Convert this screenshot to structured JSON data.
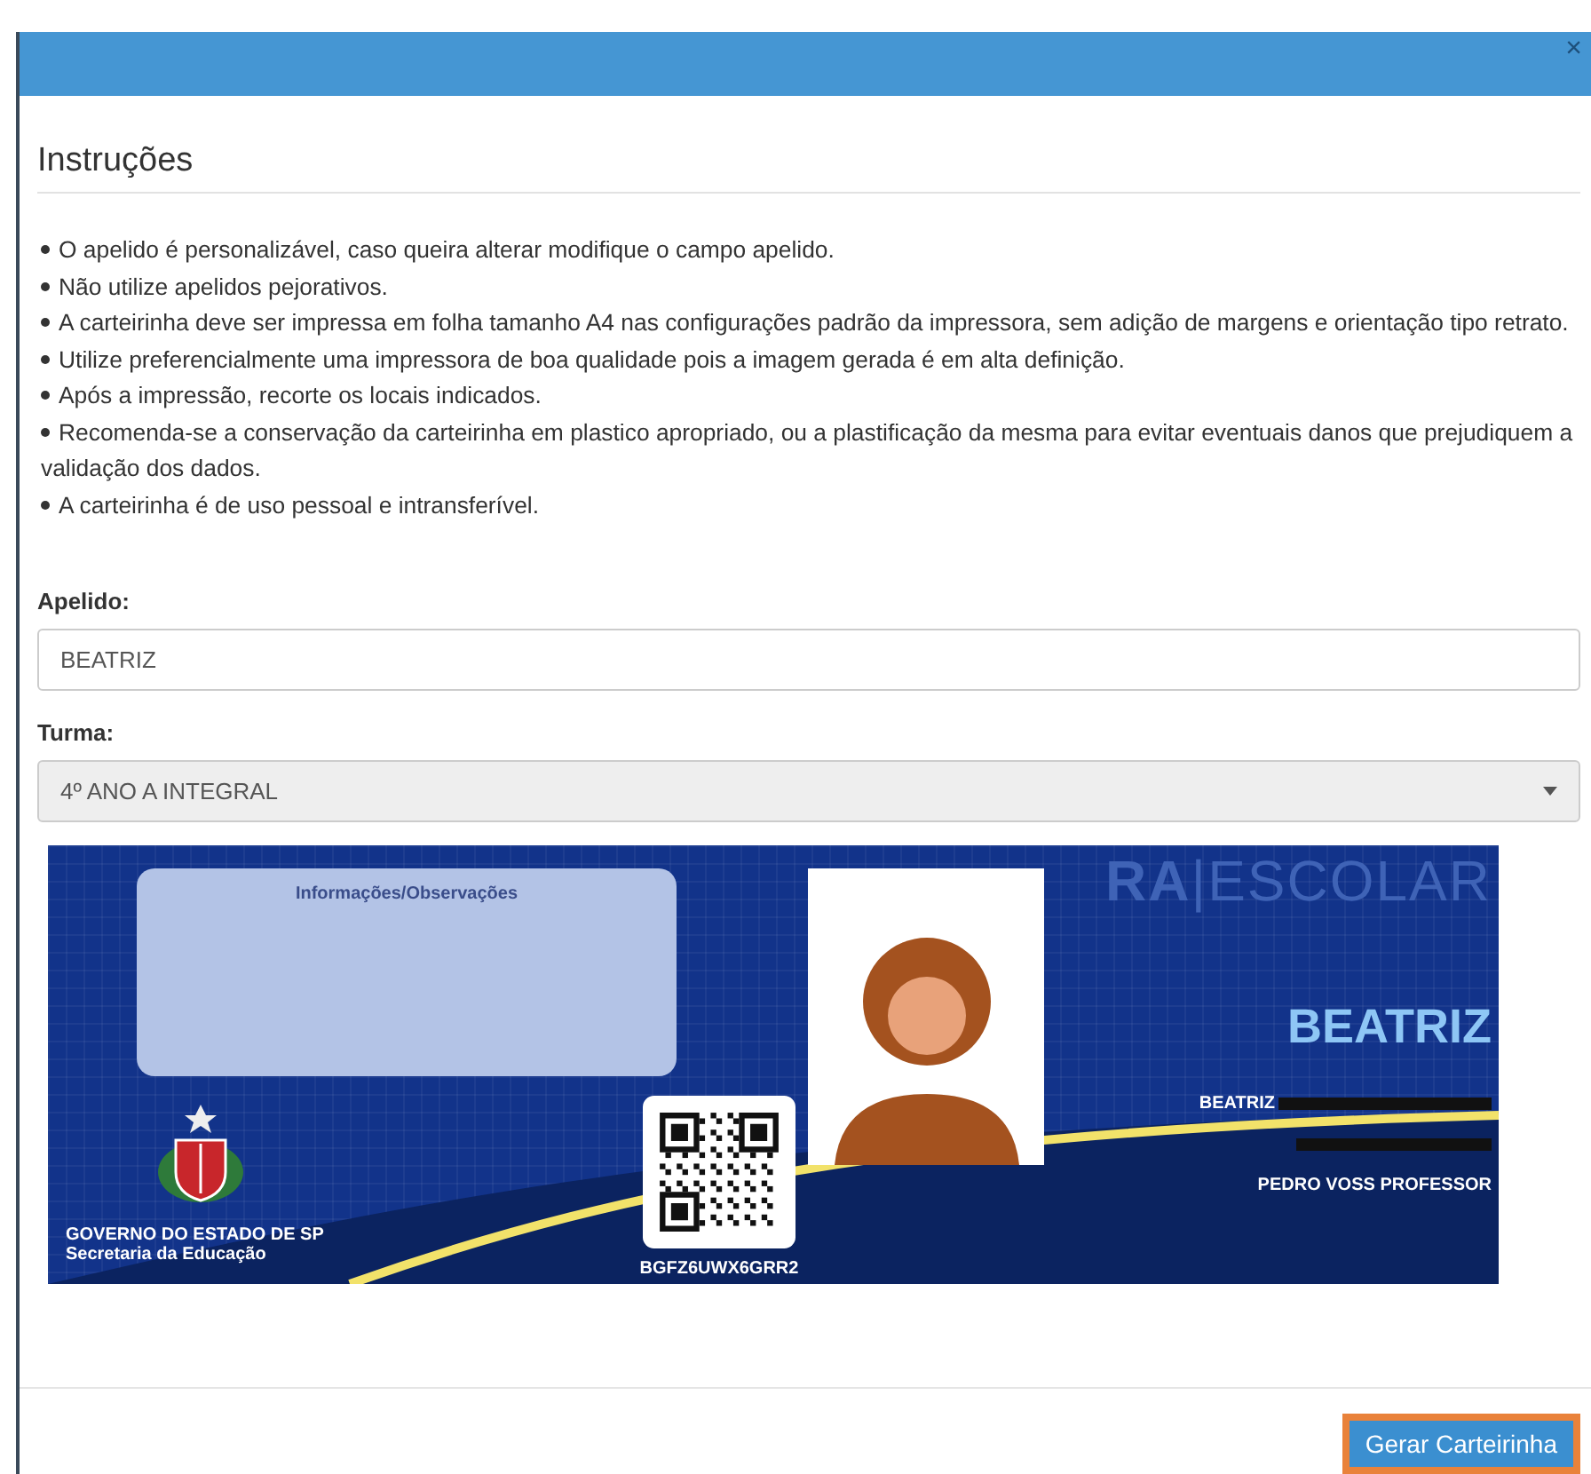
{
  "modal": {
    "close": "×",
    "title": "Instruções"
  },
  "instructions": [
    "O apelido é personalizável, caso queira alterar modifique o campo apelido.",
    "Não utilize apelidos pejorativos.",
    "A carteirinha deve ser impressa em folha tamanho A4 nas configurações padrão da impressora, sem adição de margens e orientação tipo retrato.",
    "Utilize preferencialmente uma impressora de boa qualidade pois a imagem gerada é em alta definição.",
    "Após a impressão, recorte os locais indicados.",
    "Recomenda-se a conservação da carteirinha em plastico apropriado, ou a plastificação da mesma para evitar eventuais danos que prejudiquem a validação dos dados.",
    "A carteirinha é de uso pessoal e intransferível."
  ],
  "nickname": {
    "label": "Apelido:",
    "value": "BEATRIZ"
  },
  "class": {
    "label": "Turma:",
    "value": "4º ANO A INTEGRAL"
  },
  "card": {
    "notes_title": "Informações/Observações",
    "government": "GOVERNO DO ESTADO DE SP",
    "department": "Secretaria da Educação",
    "code": "BGFZ6UWX6GRR2",
    "logo": "**RA**|ESCOLAR",
    "nickname": "BEATRIZ",
    "full_name": "BEATRIZ",
    "teacher": "PEDRO VOSS PROFESSOR"
  },
  "buttons": [
    {
      "label": "Gerar Carteirinha",
      "focused": true
    }
  ]
}
